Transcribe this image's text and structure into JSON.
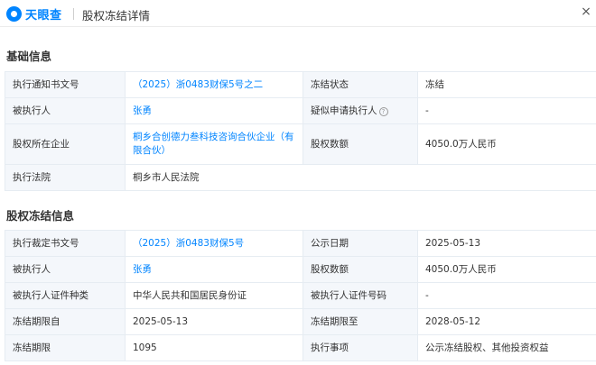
{
  "header": {
    "brand": "天眼查",
    "title": "股权冻结详情",
    "close_glyph": "×"
  },
  "basic": {
    "section_title": "基础信息",
    "rows": [
      {
        "l1": "执行通知书文号",
        "v1": "（2025）浙0483财保5号之二",
        "l2": "冻结状态",
        "v2": "冻结"
      },
      {
        "l1": "被执行人",
        "v1": "张勇",
        "l2": "疑似申请执行人",
        "v2": "-"
      },
      {
        "l1": "股权所在企业",
        "v1": "桐乡合创德力叁科技咨询合伙企业（有限合伙）",
        "l2": "股权数额",
        "v2": "4050.0万人民币"
      },
      {
        "l1": "执行法院",
        "v1": "桐乡市人民法院"
      }
    ],
    "help_glyph": "?"
  },
  "freeze": {
    "section_title": "股权冻结信息",
    "rows": [
      {
        "l1": "执行裁定书文号",
        "v1": "（2025）浙0483财保5号",
        "l2": "公示日期",
        "v2": "2025-05-13"
      },
      {
        "l1": "被执行人",
        "v1": "张勇",
        "l2": "股权数额",
        "v2": "4050.0万人民币"
      },
      {
        "l1": "被执行人证件种类",
        "v1": "中华人民共和国居民身份证",
        "l2": "被执行人证件号码",
        "v2": "-"
      },
      {
        "l1": "冻结期限自",
        "v1": "2025-05-13",
        "l2": "冻结期限至",
        "v2": "2028-05-12"
      },
      {
        "l1": "冻结期限",
        "v1": "1095",
        "l2": "执行事项",
        "v2": "公示冻结股权、其他投资权益"
      }
    ]
  },
  "colors": {
    "accent": "#0084ff",
    "label_bg": "#f4f7fb",
    "border": "#e6ecf2"
  },
  "icons": [
    "tianyancha-logo-icon",
    "close-icon",
    "help-icon"
  ]
}
